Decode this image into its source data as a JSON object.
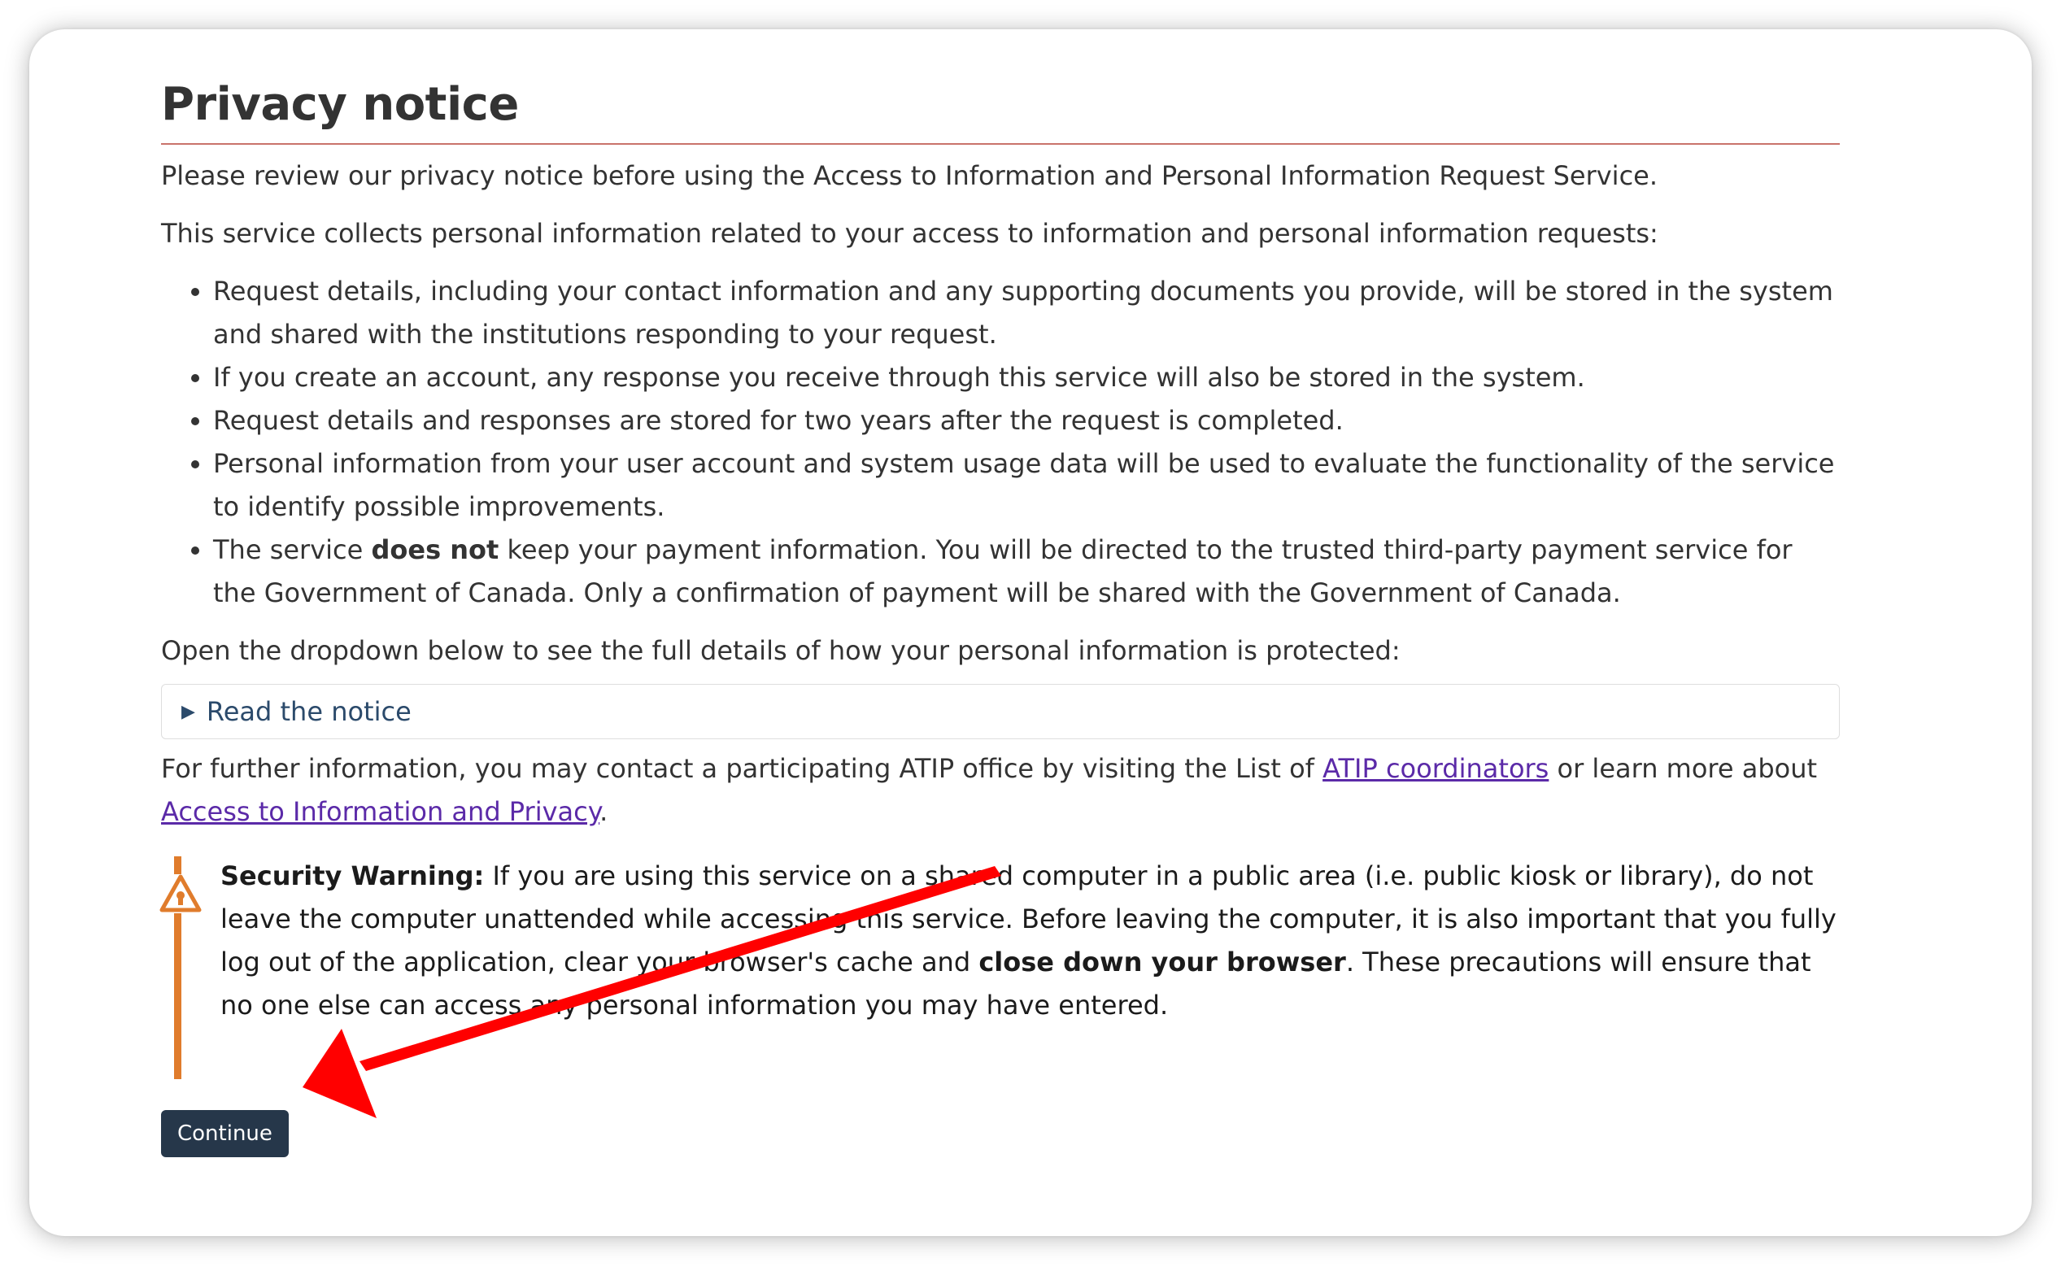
{
  "page": {
    "title": "Privacy notice",
    "intro": "Please review our privacy notice before using the Access to Information and Personal Information Request Service.",
    "collects": "This service collects personal information related to your access to information and personal information requests:",
    "items": [
      "Request details, including your contact information and any supporting documents you provide, will be stored in the system and shared with the institutions responding to your request.",
      "If you create an account, any response you receive through this service will also be stored in the system.",
      "Request details and responses are stored for two years after the request is completed.",
      "Personal information from your user account and system usage data will be used to evaluate the functionality of the service to identify possible improvements."
    ],
    "payment_item": {
      "before": "The service ",
      "bold": "does not",
      "after": " keep your payment information. You will be directed to the trusted third-party payment service for the Government of Canada. Only a confirmation of payment will be shared with the Government of Canada."
    },
    "dropdown_lead": "Open the dropdown below to see the full details of how your personal information is protected:",
    "details_summary": "Read the notice",
    "further": {
      "before": "For further information, you may contact a participating ATIP office by visiting the List of ",
      "link1": "ATIP coordinators",
      "middle": " or learn more about ",
      "link2": "Access to Information and Privacy",
      "after": "."
    },
    "warning": {
      "label": "Security Warning:",
      "text1": " If you are using this service on a shared computer in a public area (i.e. public kiosk or library), do not leave the computer unattended while accessing this service. Before leaving the computer, it is also important that you fully log out of the application, clear your browser's cache and ",
      "bold2": "close down your browser",
      "text2": ". These precautions will ensure that no one else can access any personal information you may have entered."
    },
    "continue_label": "Continue"
  },
  "colors": {
    "accent_border": "#c9736b",
    "warning_orange": "#e07c2c",
    "button_bg": "#26374a",
    "link": "#5b2aa8",
    "annotation_arrow": "#ff0000"
  },
  "icons": {
    "warning": "warning-triangle-icon",
    "summary": "triangle-right-icon"
  }
}
